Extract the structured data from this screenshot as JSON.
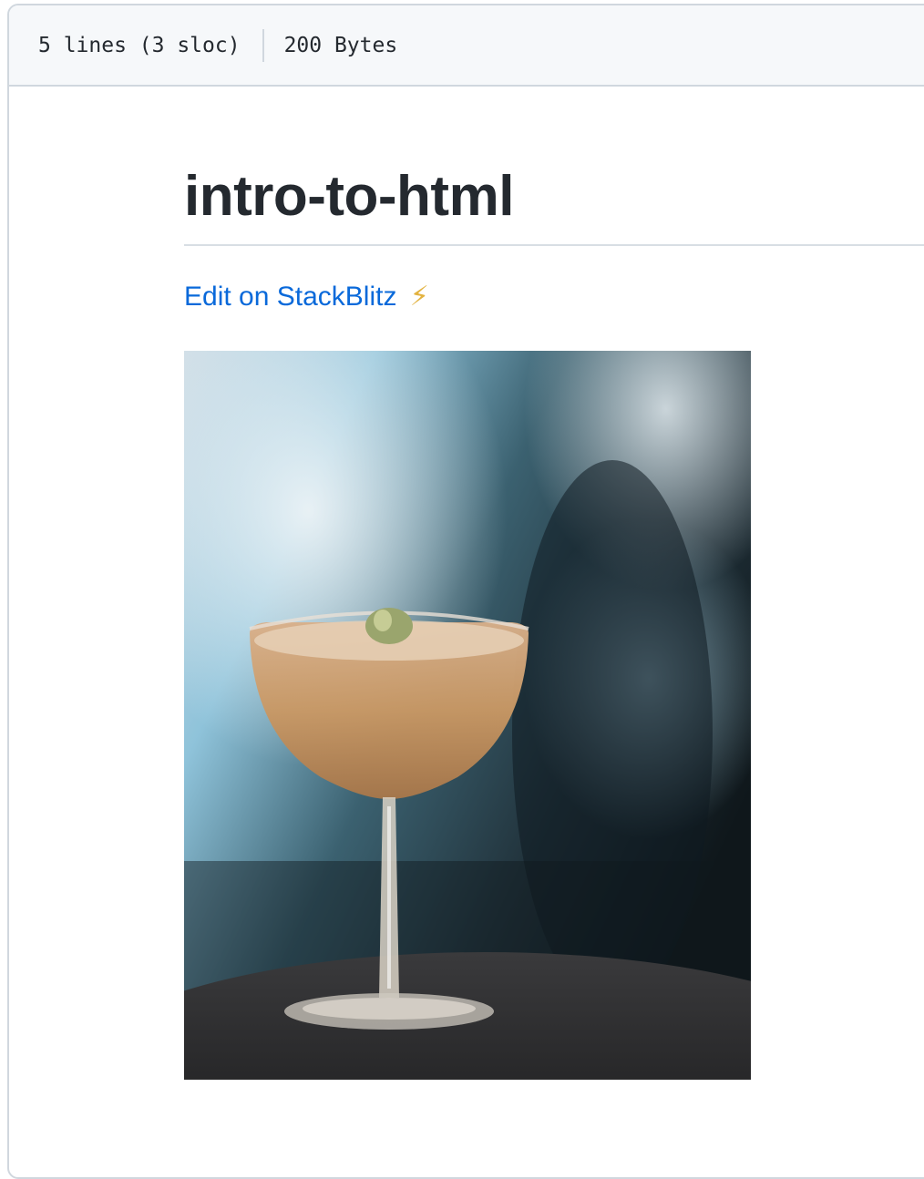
{
  "file_info": {
    "lines": "5 lines (3 sloc)",
    "size": "200 Bytes"
  },
  "readme": {
    "title": "intro-to-html",
    "link_label": "Edit on StackBlitz",
    "link_emoji": "⚡"
  },
  "image": {
    "subject": "cocktail-coupe-glass"
  },
  "colors": {
    "link": "#0969da",
    "header_bg": "#f6f8fa",
    "border": "#d0d7de",
    "text": "#24292f"
  }
}
